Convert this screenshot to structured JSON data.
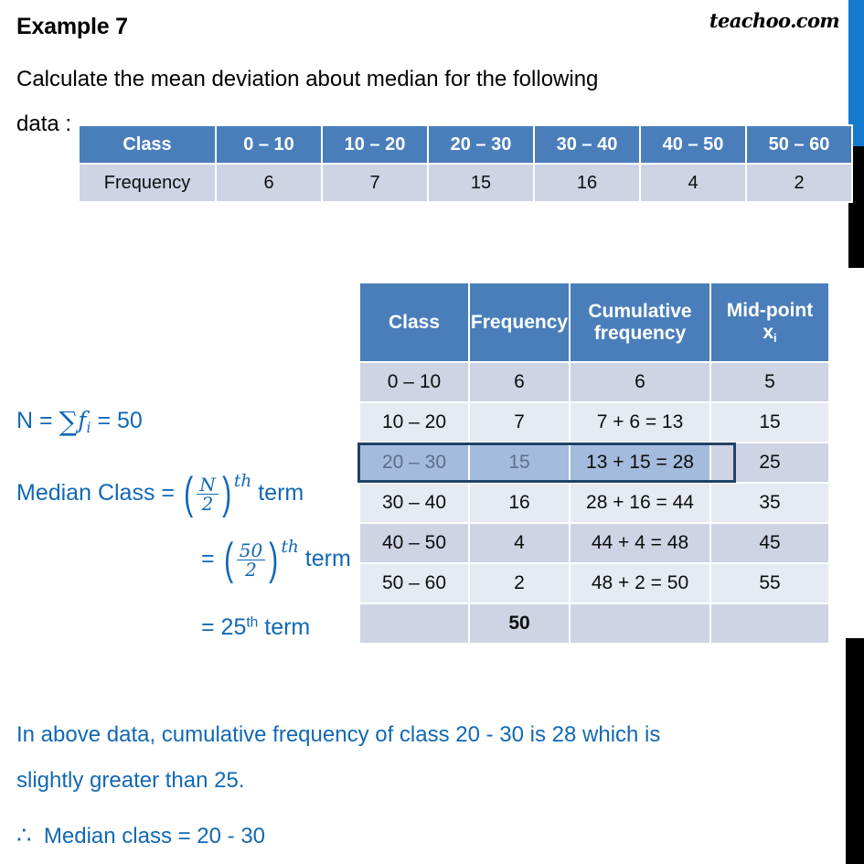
{
  "header": {
    "example_title": "Example 7",
    "brand": "teachoo.com",
    "question_line1": "Calculate the mean deviation about median for the following",
    "question_line2": "data :"
  },
  "question_table": {
    "headers": [
      "Class",
      "0 – 10",
      "10 – 20",
      "20 – 30",
      "30 – 40",
      "40 – 50",
      "50 – 60"
    ],
    "row_label": "Frequency",
    "frequencies": [
      "6",
      "7",
      "15",
      "16",
      "4",
      "2"
    ]
  },
  "main_table": {
    "headers": {
      "class": "Class",
      "frequency": "Frequency",
      "cumulative_line1": "Cumulative",
      "cumulative_line2": "frequency",
      "midpoint_line1": "Mid-point",
      "midpoint_symbol": "x",
      "midpoint_subscript": "i"
    },
    "rows": [
      {
        "class": "0 – 10",
        "frequency": "6",
        "cumulative": "6",
        "midpoint": "5",
        "highlighted": false
      },
      {
        "class": "10 – 20",
        "frequency": "7",
        "cumulative": "7 + 6 = 13",
        "midpoint": "15",
        "highlighted": false
      },
      {
        "class": "20 – 30",
        "frequency": "15",
        "cumulative": "13 + 15 = 28",
        "midpoint": "25",
        "highlighted": true
      },
      {
        "class": "30 – 40",
        "frequency": "16",
        "cumulative": "28 + 16 = 44",
        "midpoint": "35",
        "highlighted": false
      },
      {
        "class": "40 – 50",
        "frequency": "4",
        "cumulative": "44 + 4 = 48",
        "midpoint": "45",
        "highlighted": false
      },
      {
        "class": "50 – 60",
        "frequency": "2",
        "cumulative": "48 + 2 = 50",
        "midpoint": "55",
        "highlighted": false
      }
    ],
    "total_row": {
      "class": "",
      "frequency": "50",
      "cumulative": "",
      "midpoint": ""
    }
  },
  "math": {
    "n_label": "N =",
    "n_sigma": "∑",
    "n_f": "f",
    "n_sub": "i",
    "n_equals": "=",
    "n_value": "50",
    "median_label": "Median Class =",
    "median_num": "N",
    "median_den": "2",
    "median_sup": "th",
    "median_term": "term",
    "eq50_equals": "=",
    "eq50_num": "50",
    "eq50_den": "2",
    "eq50_sup": "th",
    "eq50_term": "term",
    "eq25_equals": "= 25",
    "eq25_sup": "th",
    "eq25_term": "term"
  },
  "conclusion": {
    "line1": "In above data, cumulative frequency of class 20 - 30 is 28 which is",
    "line2": "slightly greater than 25.",
    "therefore_symbol": "∴",
    "line3": "Median class = 20 - 30"
  },
  "colors": {
    "header_blue": "#4a7ebb",
    "row_dark": "#ced4e4",
    "row_light": "#e6eaf3",
    "highlight_fill": "#a3bbdd",
    "highlight_border": "#1f4267",
    "text_blue": "#1268b3",
    "edge_blue": "#1279cd",
    "black": "#000000"
  },
  "chart_data": {
    "type": "table",
    "title": "Mean deviation about median — frequency distribution",
    "categories": [
      "0 – 10",
      "10 – 20",
      "20 – 30",
      "30 – 40",
      "40 – 50",
      "50 – 60"
    ],
    "series": [
      {
        "name": "Frequency",
        "values": [
          6,
          7,
          15,
          16,
          4,
          2
        ]
      },
      {
        "name": "Cumulative frequency",
        "values": [
          6,
          13,
          28,
          44,
          48,
          50
        ]
      },
      {
        "name": "Mid-point xi",
        "values": [
          5,
          15,
          25,
          35,
          45,
          55
        ]
      }
    ],
    "total_frequency": 50,
    "median_term": 25,
    "median_class": "20 - 30",
    "xlabel": "Class",
    "ylabel": "Frequency",
    "legend": "none",
    "grid": false
  }
}
